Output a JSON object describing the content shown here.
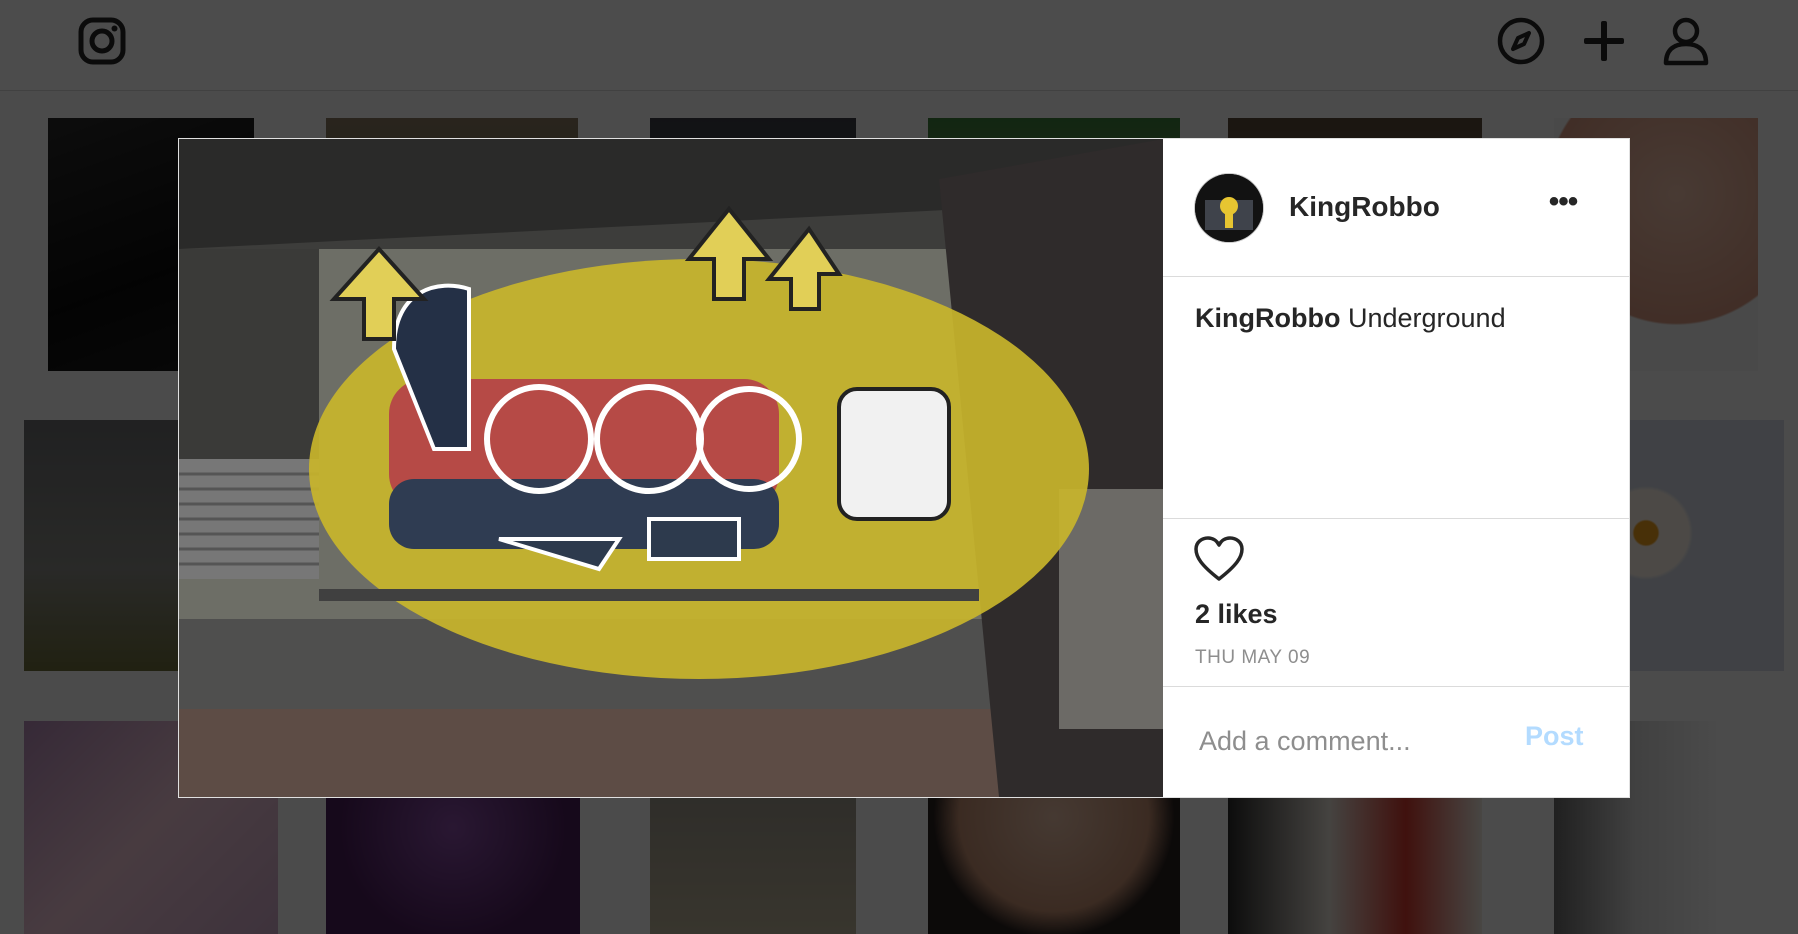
{
  "topbar": {
    "logo_icon": "instagram-icon",
    "explore_icon": "compass-icon",
    "new_post_icon": "plus-icon",
    "profile_icon": "user-icon"
  },
  "modal": {
    "author": {
      "username": "KingRobbo",
      "avatar_icon": "avatar-icon"
    },
    "more_label": "•••",
    "caption": {
      "username": "KingRobbo",
      "text": "Underground"
    },
    "like_icon": "heart-outline-icon",
    "likes_text": "2 likes",
    "date": "THU MAY 09",
    "comment": {
      "placeholder": "Add a comment...",
      "value": "",
      "post_label": "Post"
    }
  }
}
